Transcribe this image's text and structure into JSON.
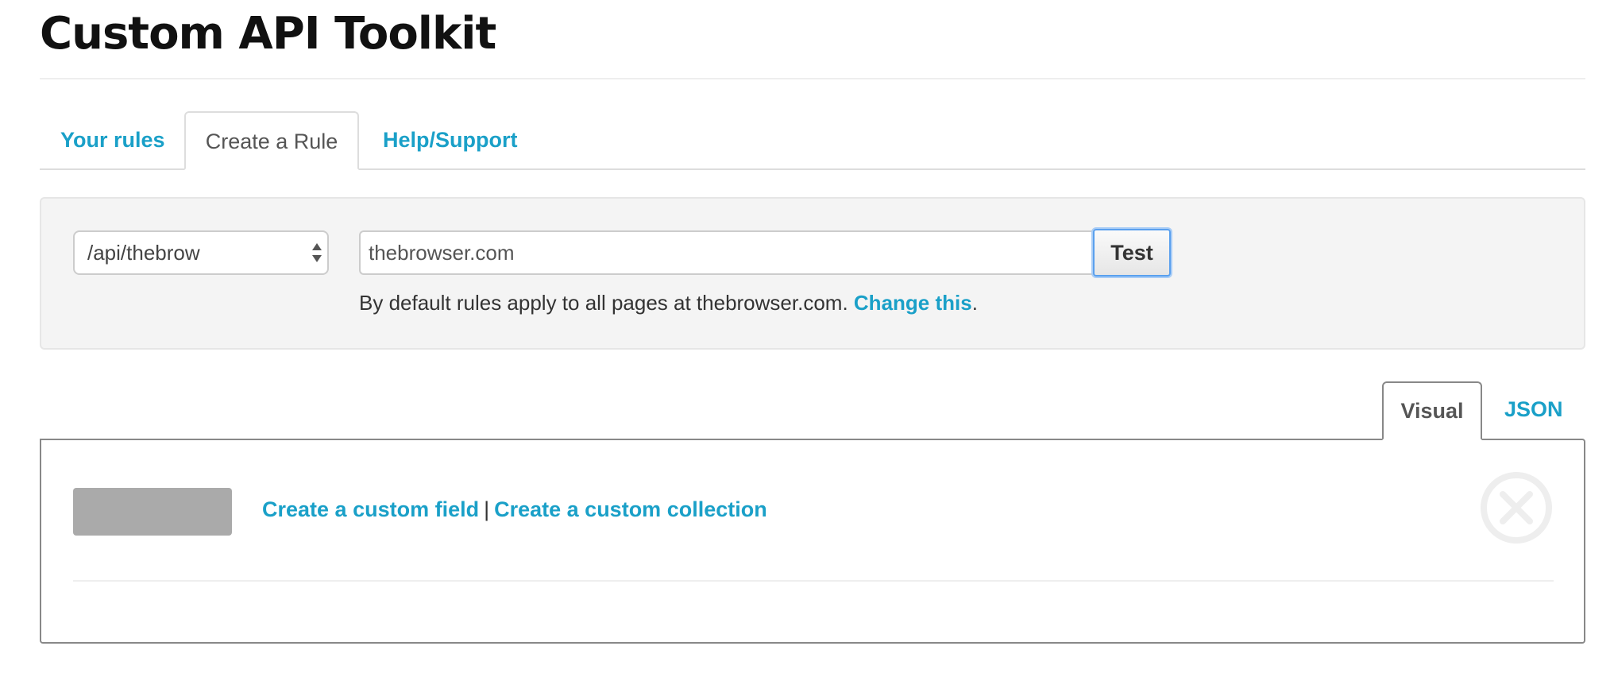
{
  "page": {
    "title": "Custom API Toolkit"
  },
  "tabs": [
    {
      "label": "Your rules",
      "active": false
    },
    {
      "label": "Create a Rule",
      "active": true
    },
    {
      "label": "Help/Support",
      "active": false
    }
  ],
  "rule_form": {
    "api_select_value": "/api/thebrow",
    "url_value": "thebrowser.com",
    "test_label": "Test",
    "hint_text": "By default rules apply to all pages at thebrowser.com. ",
    "hint_link": "Change this",
    "hint_end": "."
  },
  "editor_tabs": [
    {
      "label": "Visual",
      "active": true
    },
    {
      "label": "JSON",
      "active": false
    }
  ],
  "editor": {
    "create_field_link": "Create a custom field",
    "separator": "|",
    "create_collection_link": "Create a custom collection"
  },
  "icons": {
    "select_arrows": "updown-arrows-icon",
    "remove": "close-circle-icon"
  },
  "colors": {
    "link": "#1aa0c8",
    "focus_ring": "#5aa0ee",
    "placeholder_button": "#aaaaaa",
    "well_background": "#f4f4f4"
  }
}
